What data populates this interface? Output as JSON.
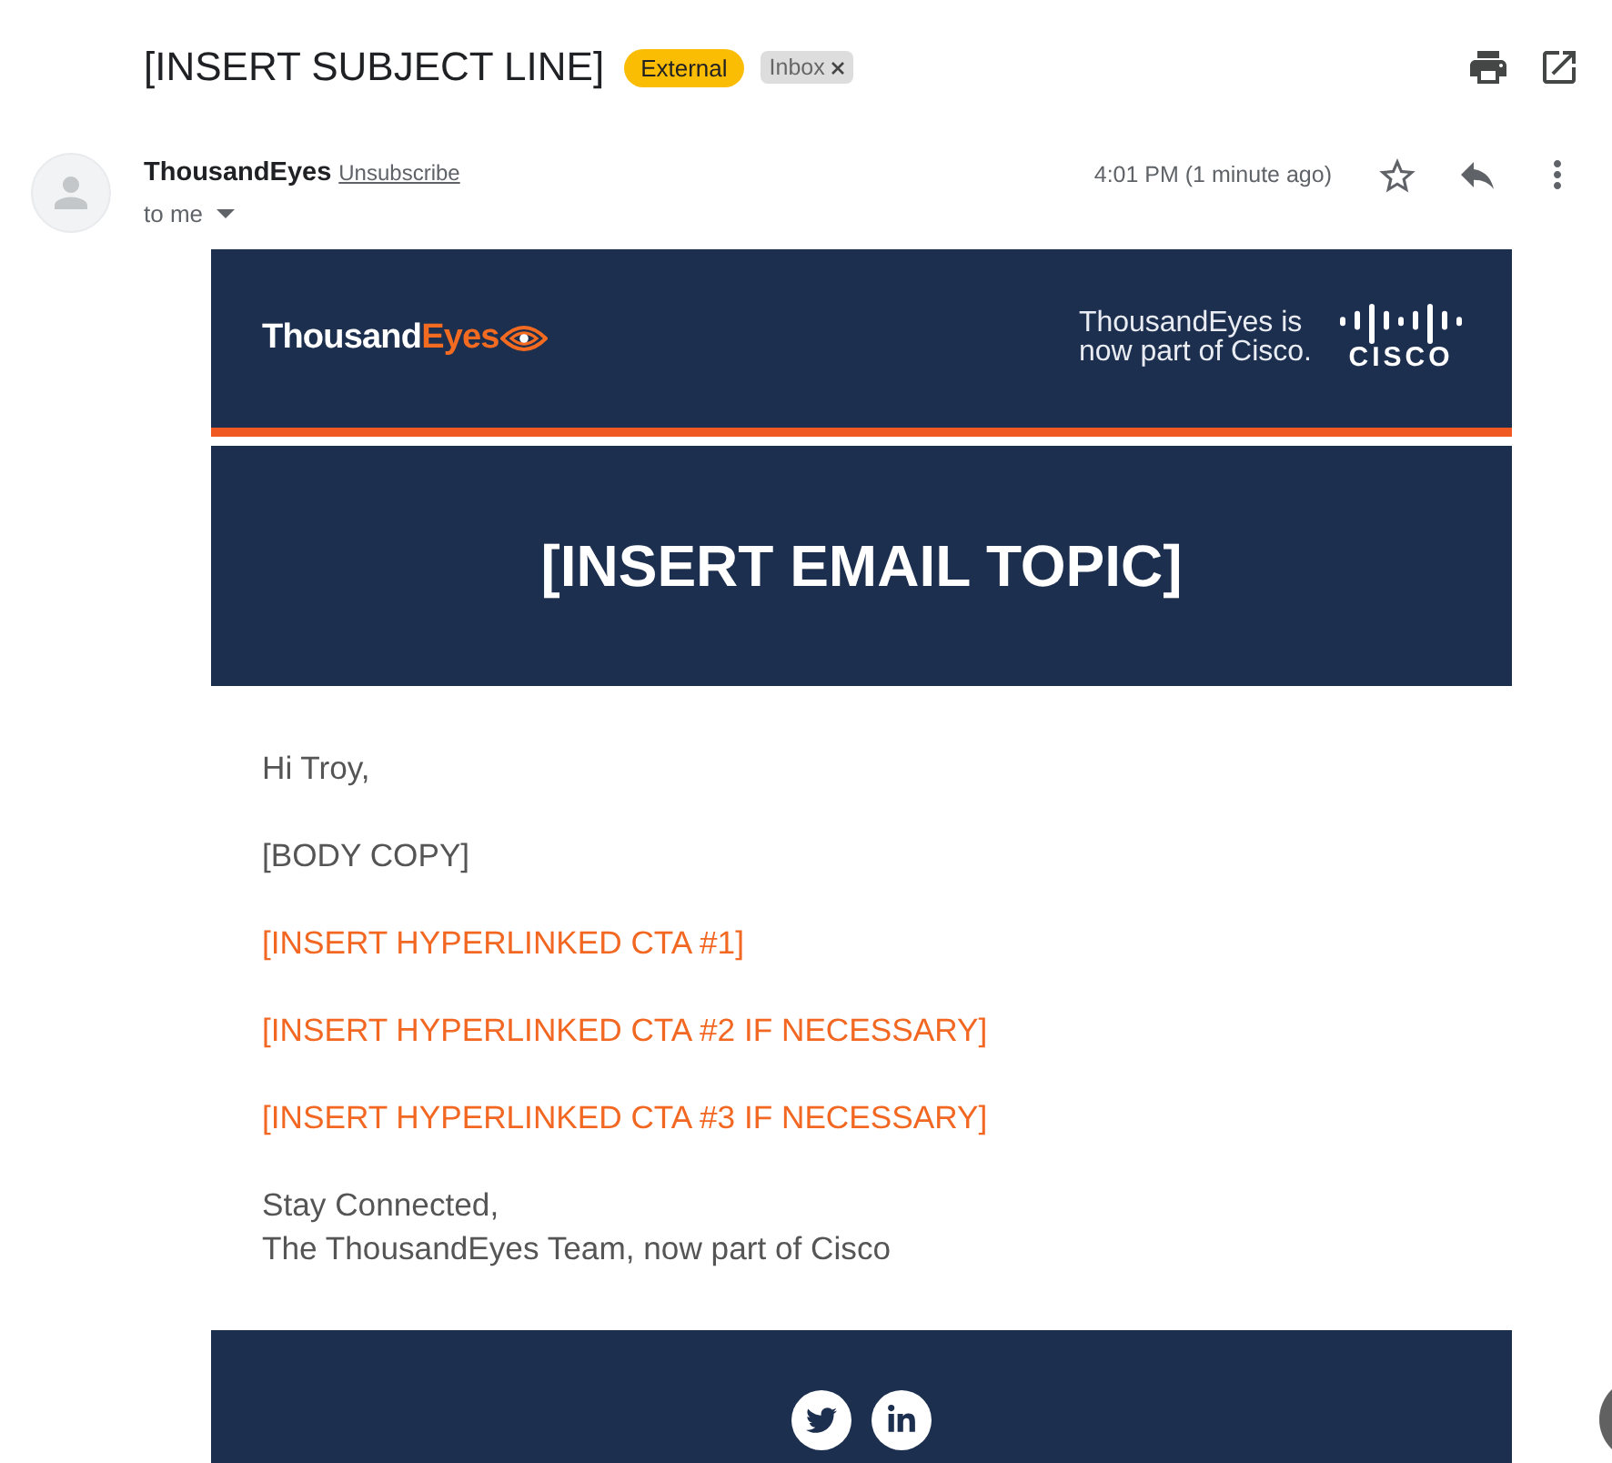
{
  "header": {
    "subject": "[INSERT SUBJECT LINE]",
    "labels": [
      {
        "kind": "category",
        "text": "External",
        "removable": false
      },
      {
        "kind": "folder",
        "text": "Inbox",
        "removable": true
      }
    ]
  },
  "message": {
    "sender": "ThousandEyes",
    "unsubscribe": "Unsubscribe",
    "recipient": "to me",
    "time": "4:01 PM (1 minute ago)",
    "starred": false
  },
  "email": {
    "banner": {
      "logo": {
        "first": "Thousand",
        "second": "Eyes"
      },
      "tagline": [
        "ThousandEyes is",
        "now part of Cisco."
      ],
      "partner_logo": "CISCO"
    },
    "topic": "[INSERT EMAIL TOPIC]",
    "body": [
      {
        "kind": "text",
        "lines": [
          "Hi Troy,"
        ]
      },
      {
        "kind": "text",
        "lines": [
          "[BODY COPY]"
        ]
      },
      {
        "kind": "link",
        "lines": [
          "[INSERT HYPERLINKED CTA #1]"
        ]
      },
      {
        "kind": "link",
        "lines": [
          "[INSERT HYPERLINKED CTA #2 IF NECESSARY]"
        ]
      },
      {
        "kind": "link",
        "lines": [
          "[INSERT HYPERLINKED CTA #3 IF NECESSARY]"
        ]
      },
      {
        "kind": "text",
        "lines": [
          "Stay Connected,",
          "The ThousandEyes Team, now part of Cisco"
        ]
      }
    ],
    "footer": {
      "social": [
        {
          "kind": "twitter"
        },
        {
          "kind": "linkedin"
        }
      ]
    }
  }
}
